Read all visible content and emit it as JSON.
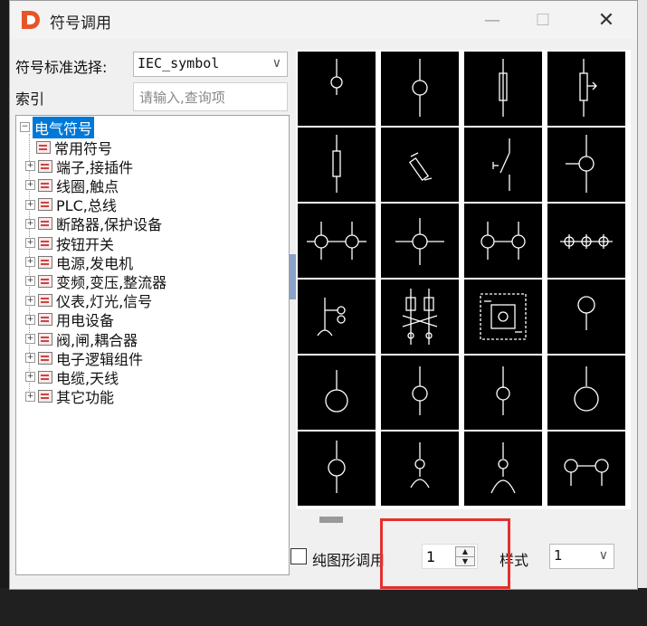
{
  "window": {
    "title": "符号调用",
    "minimize": "—",
    "maximize": "☐",
    "close": "✕",
    "logo_letter": "D"
  },
  "standard": {
    "label": "符号标准选择:",
    "value": "IEC_symbol"
  },
  "index": {
    "label": "索引",
    "placeholder": "请输入,查询项"
  },
  "tree": {
    "root": "电气符号",
    "items": [
      "常用符号",
      "端子,接插件",
      "线圈,触点",
      "PLC,总线",
      "断路器,保护设备",
      "按钮开关",
      "电源,发电机",
      "变频,变压,整流器",
      "仪表,灯光,信号",
      "用电设备",
      "阀,闸,耦合器",
      "电子逻辑组件",
      "电缆,天线",
      "其它功能"
    ]
  },
  "symbols": [
    "symbol-1",
    "symbol-2",
    "symbol-3",
    "symbol-4",
    "symbol-5",
    "symbol-6",
    "symbol-7",
    "symbol-8",
    "symbol-9",
    "symbol-10",
    "symbol-11",
    "symbol-12",
    "symbol-13",
    "symbol-14",
    "symbol-15",
    "symbol-16",
    "symbol-17",
    "symbol-18",
    "symbol-19",
    "symbol-20",
    "symbol-21",
    "symbol-22",
    "symbol-23",
    "symbol-24"
  ],
  "options": {
    "pure_graphic_label": "纯图形调用",
    "pure_graphic_checked": false,
    "count_value": "1",
    "style_label": "样式",
    "style_value": "1"
  },
  "colors": {
    "highlight": "#e53030",
    "selection": "#0078d7",
    "symbol_bg": "#000000"
  }
}
